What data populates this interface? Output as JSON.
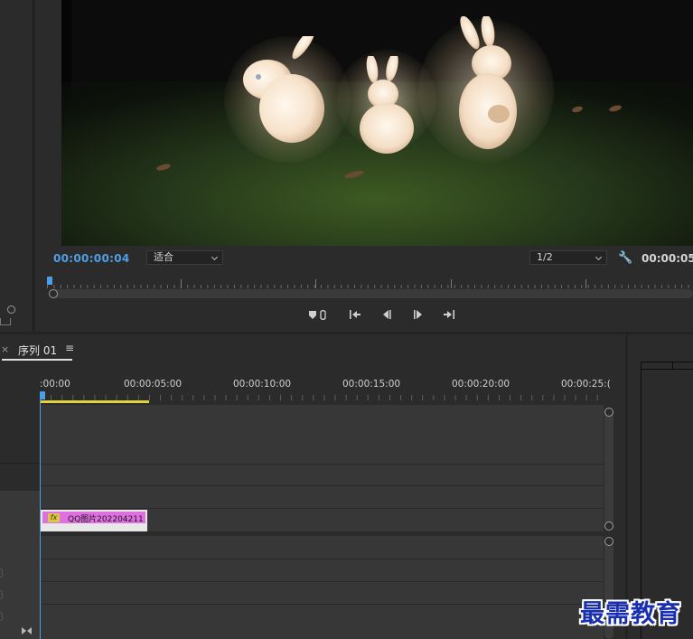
{
  "program_monitor": {
    "current_timecode": "00:00:00:04",
    "fit_dropdown": "适合",
    "resolution_dropdown": "1/2",
    "duration_timecode": "00:00:05",
    "settings_icon": "wrench-icon"
  },
  "transport": {
    "marker_icon": "marker-icon",
    "go_in_icon": "go-to-in-icon",
    "step_back_icon": "step-back-icon",
    "play_icon": "play-icon",
    "go_out_icon": "go-to-out-icon"
  },
  "timeline": {
    "tab_close": "×",
    "sequence_tab": "序列 01",
    "tab_menu": "≡",
    "ruler_labels": [
      ":00:00",
      "00:00:05:00",
      "00:00:10:00",
      "00:00:15:00",
      "00:00:20:00",
      "00:00:25:("
    ],
    "clip": {
      "fx_label": "fx",
      "name": "QQ图片202204211"
    },
    "header_icon": "collapse-icon",
    "colors": {
      "playhead": "#4a9fe8",
      "work_area": "#e2d33a",
      "clip": "#e06fe0"
    }
  },
  "watermark": "最需教育"
}
